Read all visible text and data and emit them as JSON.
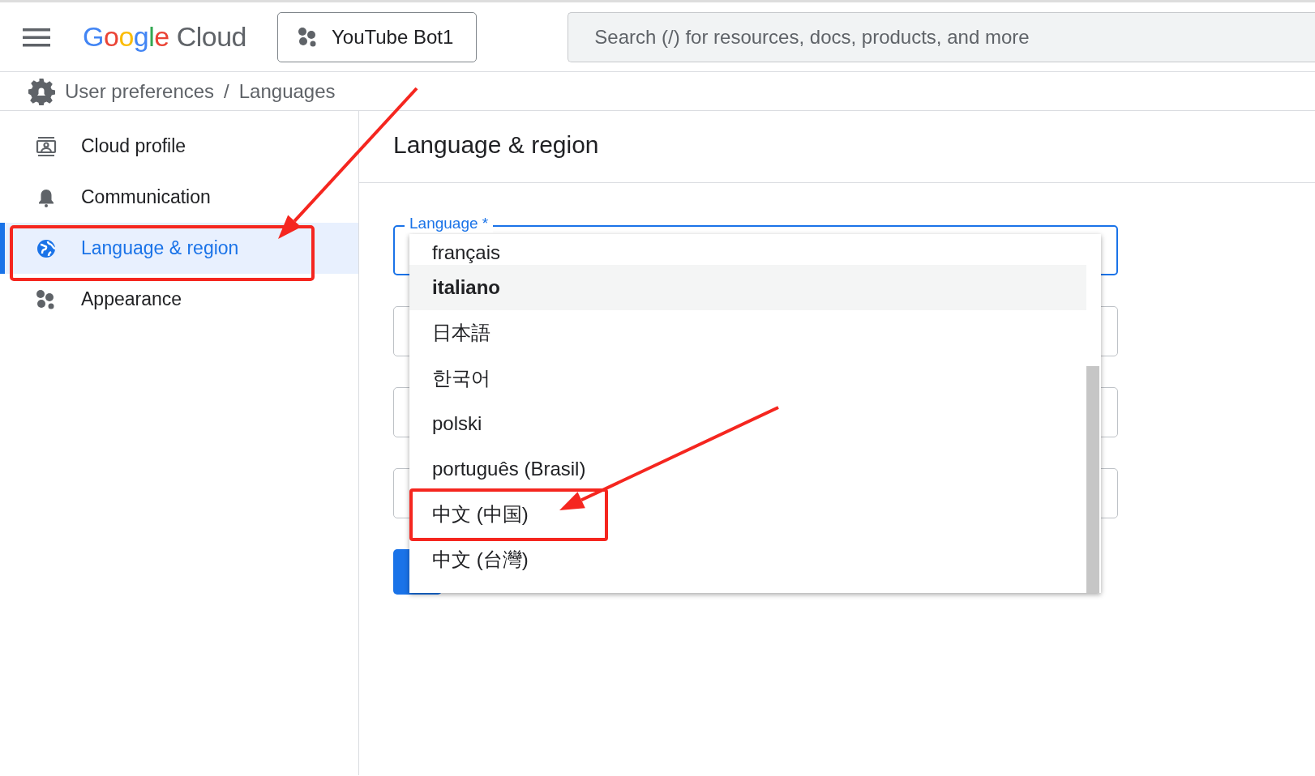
{
  "header": {
    "logo": {
      "brand": "Google",
      "product": "Cloud"
    },
    "project": "YouTube Bot1",
    "search": {
      "placeholder": "Search (/) for resources, docs, products, and more"
    }
  },
  "breadcrumb": {
    "items": [
      "User preferences",
      "Languages"
    ],
    "separator": "/"
  },
  "sidebar": {
    "items": [
      {
        "label": "Cloud profile",
        "kind": "profile",
        "selected": false
      },
      {
        "label": "Communication",
        "kind": "bell",
        "selected": false
      },
      {
        "label": "Language & region",
        "kind": "globe",
        "selected": true
      },
      {
        "label": "Appearance",
        "kind": "hexagons",
        "selected": false
      }
    ]
  },
  "main": {
    "title": "Language & region",
    "language_field": {
      "label": "Language *",
      "focused": true
    },
    "dropdown": {
      "options": [
        {
          "label": "français",
          "selected": false
        },
        {
          "label": "italiano",
          "selected": true
        },
        {
          "label": "日本語",
          "selected": false
        },
        {
          "label": "한국어",
          "selected": false
        },
        {
          "label": "polski",
          "selected": false
        },
        {
          "label": "português (Brasil)",
          "selected": false
        },
        {
          "label": "中文 (中国)",
          "selected": false
        },
        {
          "label": "中文 (台灣)",
          "selected": false
        }
      ]
    }
  }
}
